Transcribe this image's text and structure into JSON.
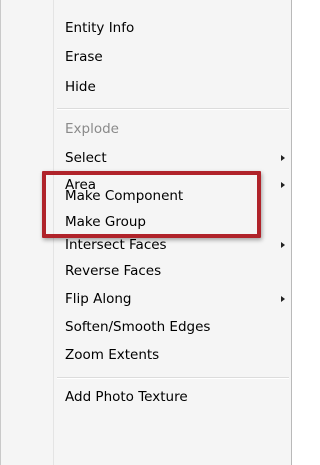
{
  "context_menu": {
    "items": [
      {
        "label": "Entity Info",
        "enabled": true,
        "submenu": false
      },
      {
        "label": "Erase",
        "enabled": true,
        "submenu": false
      },
      {
        "label": "Hide",
        "enabled": true,
        "submenu": false
      },
      {
        "label": "Explode",
        "enabled": false,
        "submenu": false
      },
      {
        "label": "Select",
        "enabled": true,
        "submenu": true
      },
      {
        "label": "Area",
        "enabled": true,
        "submenu": true
      },
      {
        "label": "Make Component",
        "enabled": true,
        "submenu": false
      },
      {
        "label": "Make Group",
        "enabled": true,
        "submenu": false
      },
      {
        "label": "Intersect Faces",
        "enabled": true,
        "submenu": true
      },
      {
        "label": "Reverse Faces",
        "enabled": true,
        "submenu": false
      },
      {
        "label": "Flip Along",
        "enabled": true,
        "submenu": true
      },
      {
        "label": "Soften/Smooth Edges",
        "enabled": true,
        "submenu": false
      },
      {
        "label": "Zoom Extents",
        "enabled": true,
        "submenu": false
      },
      {
        "label": "Add Photo Texture",
        "enabled": true,
        "submenu": false
      }
    ]
  },
  "annotation": {
    "highlight_color": "#b0232a",
    "highlighted_items": [
      "Make Component",
      "Make Group"
    ]
  }
}
